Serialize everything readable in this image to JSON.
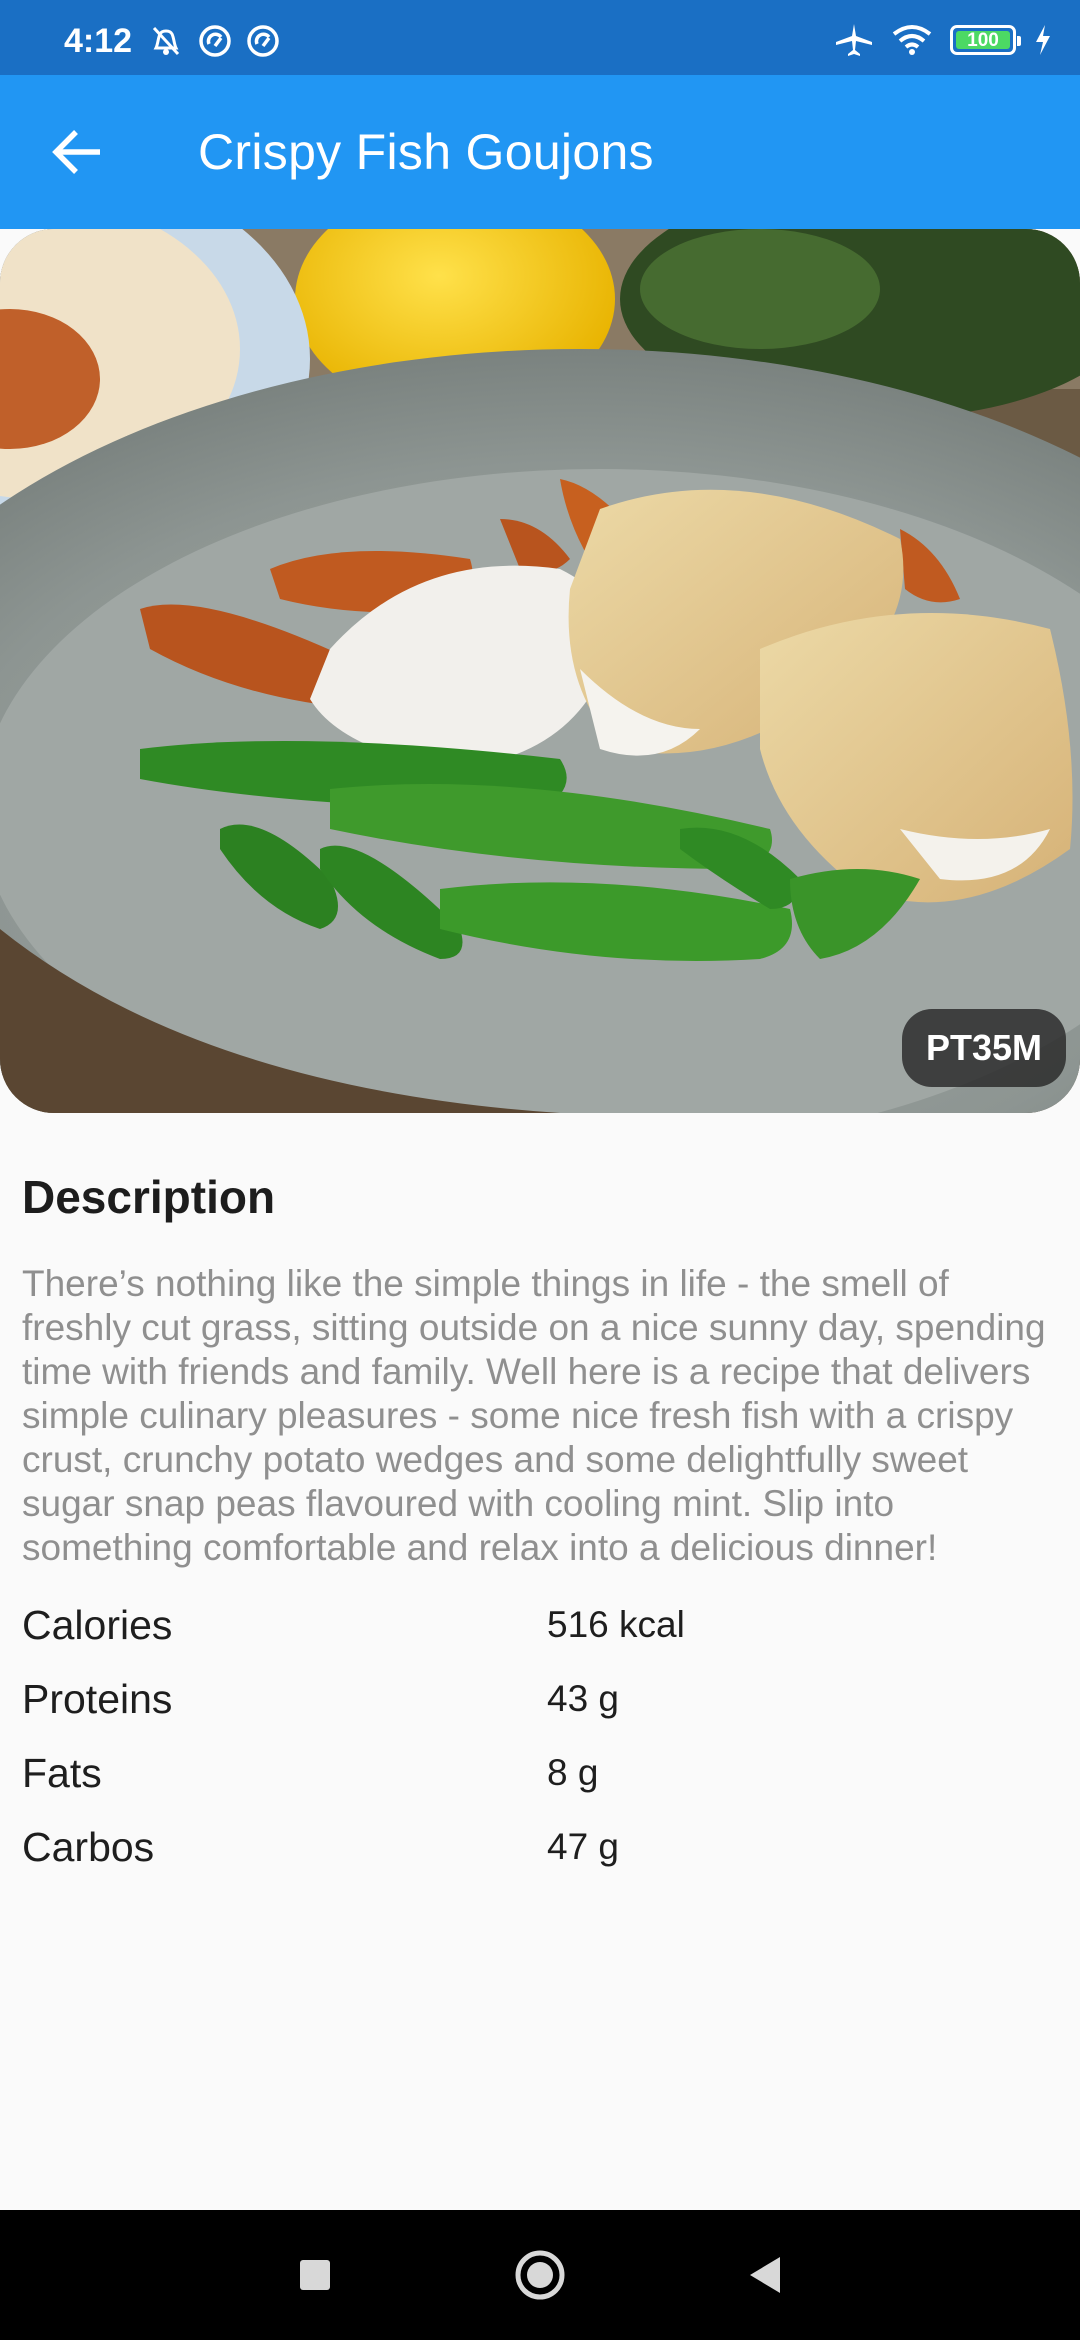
{
  "status": {
    "time": "4:12",
    "battery": "100",
    "battery_level": 1.0
  },
  "app_bar": {
    "title": "Crispy Fish Goujons"
  },
  "hero": {
    "duration_badge": "PT35M"
  },
  "description": {
    "title": "Description",
    "text": "There’s nothing like the simple things in life - the smell of freshly cut grass, sitting outside on a nice sunny day, spending time with friends and family. Well here is a recipe that delivers simple culinary pleasures - some nice fresh fish with a crispy crust, crunchy potato wedges and some delightfully sweet sugar snap peas flavoured with cooling mint. Slip into something comfortable and relax into a delicious dinner!"
  },
  "nutrition": [
    {
      "label": "Calories",
      "value": "516 kcal"
    },
    {
      "label": "Proteins",
      "value": "43 g"
    },
    {
      "label": "Fats",
      "value": "8 g"
    },
    {
      "label": "Carbos",
      "value": "47 g"
    }
  ],
  "colors": {
    "status_bar": "#1a6fc4",
    "app_bar": "#2196f3",
    "background": "#fafafa",
    "description_text": "#8f8f8f"
  }
}
